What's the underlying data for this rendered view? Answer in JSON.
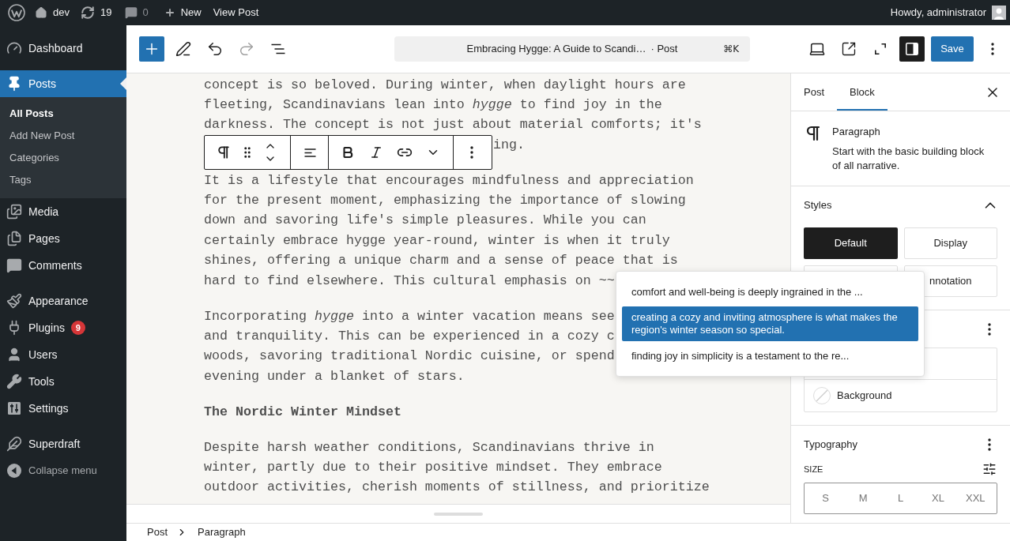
{
  "admin_bar": {
    "site": "dev",
    "updates": "19",
    "comments": "0",
    "new": "New",
    "view": "View Post",
    "greeting": "Howdy, administrator"
  },
  "admin_menu": {
    "groups": [
      [
        {
          "label": "Dashboard",
          "selected": false
        }
      ],
      [
        {
          "label": "Posts",
          "selected": true,
          "children": [
            {
              "label": "All Posts",
              "selected": true
            },
            {
              "label": "Add New Post",
              "selected": false
            },
            {
              "label": "Categories",
              "selected": false
            },
            {
              "label": "Tags",
              "selected": false
            }
          ]
        },
        {
          "label": "Media",
          "selected": false
        },
        {
          "label": "Pages",
          "selected": false
        },
        {
          "label": "Comments",
          "selected": false
        }
      ],
      [
        {
          "label": "Appearance",
          "selected": false
        },
        {
          "label": "Plugins",
          "selected": false,
          "badge": "9"
        },
        {
          "label": "Users",
          "selected": false
        },
        {
          "label": "Tools",
          "selected": false
        },
        {
          "label": "Settings",
          "selected": false
        }
      ],
      [
        {
          "label": "Superdraft",
          "selected": false
        }
      ]
    ],
    "collapse": "Collapse menu"
  },
  "editor_header": {
    "undo": {
      "disabled": false
    },
    "redo": {
      "disabled": true
    },
    "document_title": "Embracing Hygge: A Guide to Scandi…",
    "document_type": "· Post",
    "shortcut": "⌘K",
    "settings_toggle": {
      "pressed": true
    },
    "save": "Save"
  },
  "content": {
    "blocks": [
      {
        "kind": "paragraph",
        "lines": [
          "concept is so beloved. During winter, when daylight hours are",
          "fleeting, Scandinavians lean into *hygge* to find joy in the",
          "darkness. The concept is not just about material comforts; it's"
        ],
        "tail": "ing."
      },
      {
        "kind": "paragraph",
        "lines": [
          "It is a lifestyle that encourages mindfulness and appreciation",
          "for the present moment, emphasizing the importance of slowing",
          "down and savoring life's simple pleasures. While you can",
          "certainly embrace hygge year-round, winter is when it truly",
          "shines, offering a unique charm and a sense of peace that is",
          "hard to find elsewhere. This cultural emphasis on ~~"
        ]
      },
      {
        "kind": "paragraph",
        "lines": [
          "Incorporating *hygge* into a winter vacation means see",
          "and tranquility. This can be experienced in a cozy c",
          "woods, savoring traditional Nordic cuisine, or spend",
          "evening under a blanket of stars."
        ]
      },
      {
        "kind": "heading",
        "text": "The Nordic Winter Mindset"
      },
      {
        "kind": "paragraph",
        "lines": [
          "Despite harsh weather conditions, Scandinavians thrive in",
          "winter, partly due to their positive mindset. They embrace",
          "outdoor activities, cherish moments of stillness, and prioritize"
        ]
      }
    ]
  },
  "autocomplete": {
    "suggestions": [
      {
        "text": "comfort and well-being is deeply ingrained in the ...",
        "selected": false
      },
      {
        "text": "creating a cozy and inviting atmosphere is what makes the region's winter season so special.",
        "selected": true
      },
      {
        "text": "finding joy in simplicity is a testament to the re...",
        "selected": false
      }
    ]
  },
  "sidebar": {
    "tabs": [
      {
        "label": "Post",
        "selected": false
      },
      {
        "label": "Block",
        "selected": true
      }
    ],
    "block_card": {
      "title": "Paragraph",
      "description": "Start with the basic building block of all narrative."
    },
    "styles": {
      "title": "Styles",
      "expanded": true,
      "options": [
        {
          "label": "Default",
          "selected": true
        },
        {
          "label": "Display",
          "selected": false
        },
        {
          "selected": false
        },
        {
          "label": "nnotation",
          "selected": false
        }
      ]
    },
    "color": {
      "options": [
        {
          "label": "Background"
        }
      ]
    },
    "typography": {
      "title": "Typography",
      "size_label": "SIZE",
      "sizes": [
        {
          "label": "S",
          "selected": false
        },
        {
          "label": "M",
          "selected": false
        },
        {
          "label": "L",
          "selected": false
        },
        {
          "label": "XL",
          "selected": false
        },
        {
          "label": "XXL",
          "selected": false
        }
      ]
    }
  },
  "footer": {
    "breadcrumbs": [
      "Post",
      "Paragraph"
    ]
  }
}
